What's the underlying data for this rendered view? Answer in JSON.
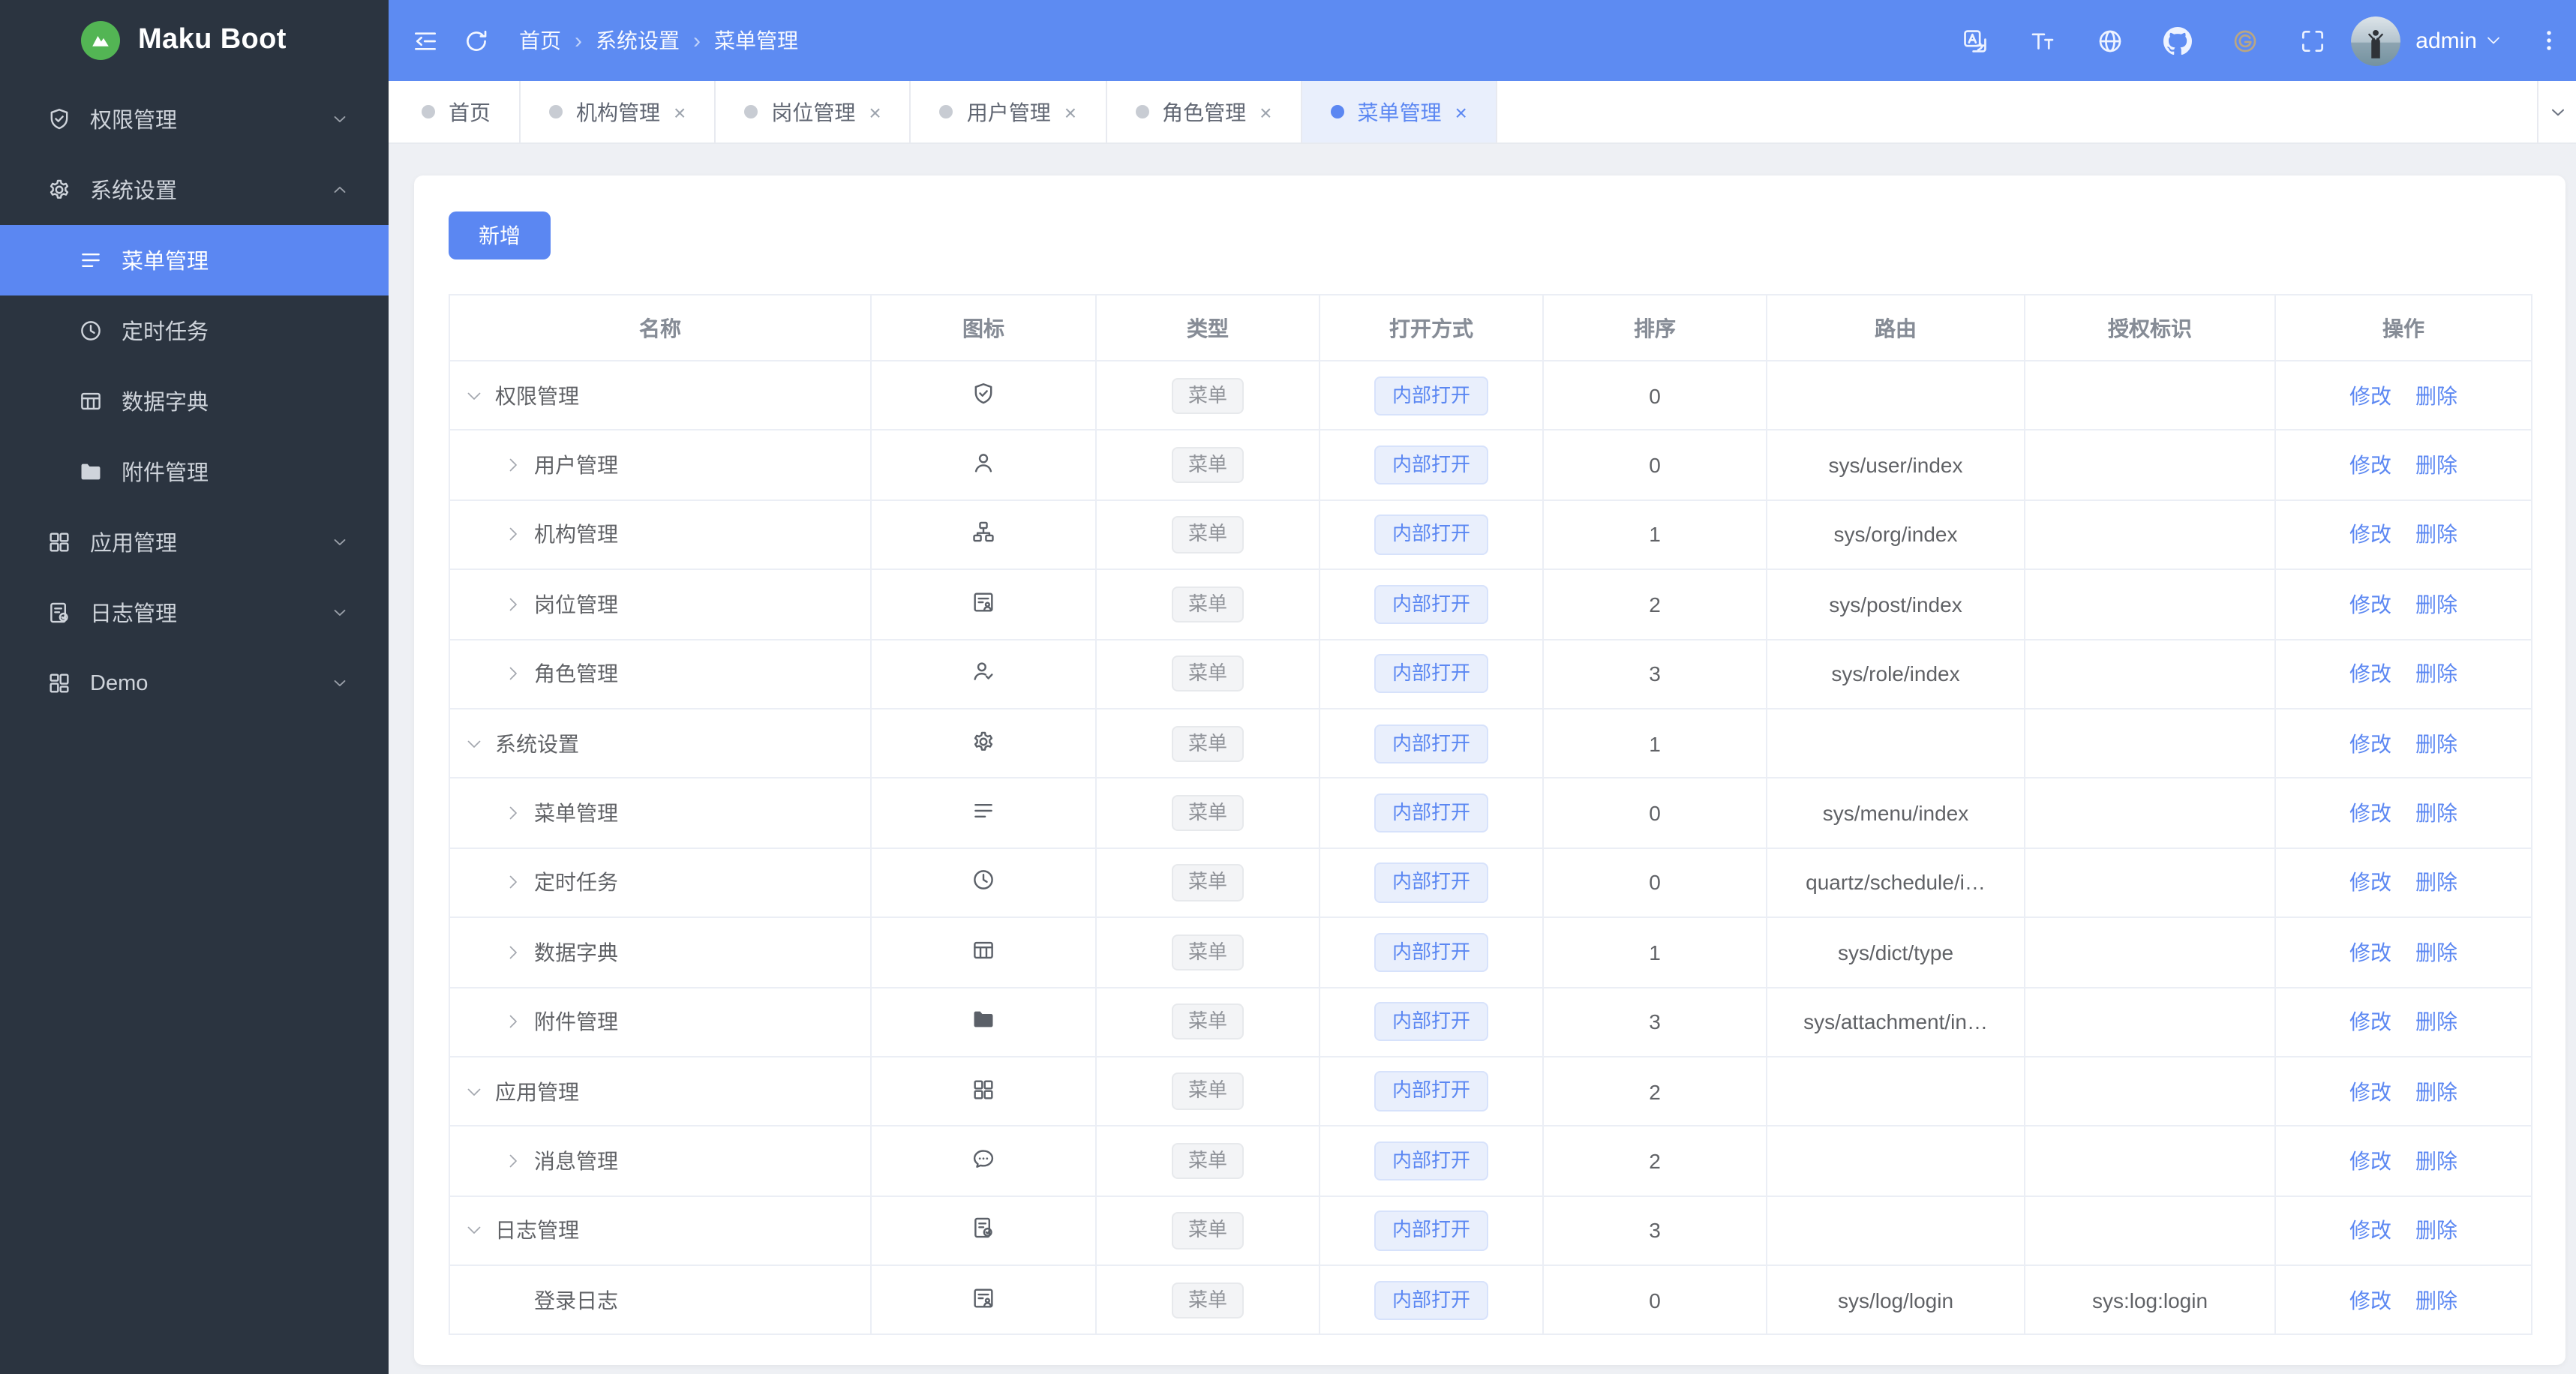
{
  "colors": {
    "primary": "#5b87f2",
    "header_bg": "#5d8bf2",
    "sidebar_bg": "#2b3440",
    "content_bg": "#eef0f4",
    "logo_green": "#53b554",
    "gitee_tan": "#b9a683",
    "tag_menu_bg": "#f3f4f6",
    "tag_menu_text": "#909399",
    "tag_open_bg": "#e9effc"
  },
  "brand": {
    "title": "Maku Boot"
  },
  "topbar": {
    "left_icons": [
      "collapse-icon",
      "refresh-icon"
    ],
    "breadcrumb": [
      "首页",
      "系统设置",
      "菜单管理"
    ],
    "right_icons": [
      "translate-icon",
      "font-size-icon",
      "globe-icon",
      "github-icon",
      "gitee-icon",
      "fullscreen-icon"
    ],
    "username": "admin"
  },
  "sidebar": {
    "items": [
      {
        "key": "permission",
        "label": "权限管理",
        "icon": "shield-check-icon",
        "chevron": "down"
      },
      {
        "key": "system",
        "label": "系统设置",
        "icon": "gear-icon",
        "chevron": "up",
        "expanded": true,
        "children": [
          {
            "key": "menu",
            "label": "菜单管理",
            "icon": "menu-icon",
            "active": true
          },
          {
            "key": "schedule",
            "label": "定时任务",
            "icon": "clock-icon"
          },
          {
            "key": "dict",
            "label": "数据字典",
            "icon": "dict-table-icon"
          },
          {
            "key": "attachment",
            "label": "附件管理",
            "icon": "folder-icon"
          }
        ]
      },
      {
        "key": "app",
        "label": "应用管理",
        "icon": "grid-icon",
        "chevron": "down"
      },
      {
        "key": "log",
        "label": "日志管理",
        "icon": "log-doc-icon",
        "chevron": "down"
      },
      {
        "key": "demo",
        "label": "Demo",
        "icon": "apps-icon",
        "chevron": "down"
      }
    ]
  },
  "tabbar": {
    "tabs": [
      {
        "key": "home",
        "label": "首页",
        "closable": false,
        "active": false
      },
      {
        "key": "org",
        "label": "机构管理",
        "closable": true,
        "active": false
      },
      {
        "key": "post",
        "label": "岗位管理",
        "closable": true,
        "active": false
      },
      {
        "key": "user",
        "label": "用户管理",
        "closable": true,
        "active": false
      },
      {
        "key": "role",
        "label": "角色管理",
        "closable": true,
        "active": false
      },
      {
        "key": "menu",
        "label": "菜单管理",
        "closable": true,
        "active": true
      }
    ]
  },
  "toolbar": {
    "add_label": "新增"
  },
  "table": {
    "columns": [
      "名称",
      "图标",
      "类型",
      "打开方式",
      "排序",
      "路由",
      "授权标识",
      "操作"
    ],
    "action_labels": [
      "修改",
      "删除"
    ],
    "rows": [
      {
        "name": "权限管理",
        "icon": "shield-check-icon",
        "level": 0,
        "expand": "down",
        "type": "菜单",
        "open": "内部打开",
        "sort": "0",
        "route": "",
        "perm": ""
      },
      {
        "name": "用户管理",
        "icon": "user-icon",
        "level": 1,
        "expand": "right",
        "type": "菜单",
        "open": "内部打开",
        "sort": "0",
        "route": "sys/user/index",
        "perm": ""
      },
      {
        "name": "机构管理",
        "icon": "org-tree-icon",
        "level": 1,
        "expand": "right",
        "type": "菜单",
        "open": "内部打开",
        "sort": "1",
        "route": "sys/org/index",
        "perm": ""
      },
      {
        "name": "岗位管理",
        "icon": "id-card-icon",
        "level": 1,
        "expand": "right",
        "type": "菜单",
        "open": "内部打开",
        "sort": "2",
        "route": "sys/post/index",
        "perm": ""
      },
      {
        "name": "角色管理",
        "icon": "user-check-icon",
        "level": 1,
        "expand": "right",
        "type": "菜单",
        "open": "内部打开",
        "sort": "3",
        "route": "sys/role/index",
        "perm": ""
      },
      {
        "name": "系统设置",
        "icon": "gear-icon",
        "level": 0,
        "expand": "down",
        "type": "菜单",
        "open": "内部打开",
        "sort": "1",
        "route": "",
        "perm": ""
      },
      {
        "name": "菜单管理",
        "icon": "menu-icon",
        "level": 1,
        "expand": "right",
        "type": "菜单",
        "open": "内部打开",
        "sort": "0",
        "route": "sys/menu/index",
        "perm": ""
      },
      {
        "name": "定时任务",
        "icon": "clock-icon",
        "level": 1,
        "expand": "right",
        "type": "菜单",
        "open": "内部打开",
        "sort": "0",
        "route": "quartz/schedule/i…",
        "perm": ""
      },
      {
        "name": "数据字典",
        "icon": "dict-table-icon",
        "level": 1,
        "expand": "right",
        "type": "菜单",
        "open": "内部打开",
        "sort": "1",
        "route": "sys/dict/type",
        "perm": ""
      },
      {
        "name": "附件管理",
        "icon": "folder-icon",
        "level": 1,
        "expand": "right",
        "type": "菜单",
        "open": "内部打开",
        "sort": "3",
        "route": "sys/attachment/in…",
        "perm": ""
      },
      {
        "name": "应用管理",
        "icon": "grid-icon",
        "level": 0,
        "expand": "down",
        "type": "菜单",
        "open": "内部打开",
        "sort": "2",
        "route": "",
        "perm": ""
      },
      {
        "name": "消息管理",
        "icon": "chat-icon",
        "level": 1,
        "expand": "right",
        "type": "菜单",
        "open": "内部打开",
        "sort": "2",
        "route": "",
        "perm": ""
      },
      {
        "name": "日志管理",
        "icon": "log-doc-icon",
        "level": 0,
        "expand": "down",
        "type": "菜单",
        "open": "内部打开",
        "sort": "3",
        "route": "",
        "perm": ""
      },
      {
        "name": "登录日志",
        "icon": "id-card-icon",
        "level": 1,
        "expand": "none",
        "type": "菜单",
        "open": "内部打开",
        "sort": "0",
        "route": "sys/log/login",
        "perm": "sys:log:login"
      }
    ]
  }
}
